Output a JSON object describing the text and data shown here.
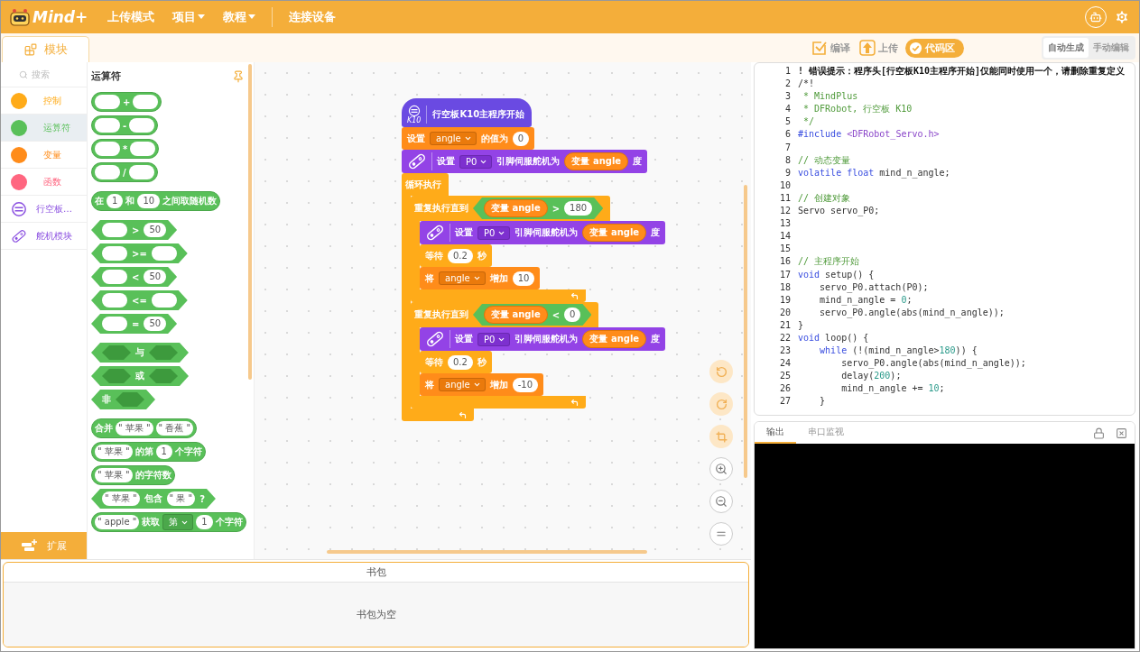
{
  "topbar": {
    "logo": "Mind+",
    "menus": [
      {
        "label": "上传模式",
        "dropdown": false
      },
      {
        "label": "项目",
        "dropdown": true
      },
      {
        "label": "教程",
        "dropdown": true
      }
    ],
    "connect": "连接设备"
  },
  "toolbar": {
    "tab": {
      "label": "模块",
      "selected": true
    },
    "actions": [
      {
        "label": "编译",
        "kind": "compile",
        "selected": false
      },
      {
        "label": "上传",
        "kind": "upload",
        "selected": false
      },
      {
        "label": "代码区",
        "kind": "code",
        "selected": true
      }
    ],
    "modes": [
      {
        "label": "自动生成",
        "selected": true
      },
      {
        "label": "手动编辑",
        "selected": false
      }
    ]
  },
  "categories": {
    "search": {
      "placeholder": "搜索"
    },
    "items": [
      {
        "label": "控制",
        "kind": "dot",
        "color": "#ffab19",
        "selected": false
      },
      {
        "label": "运算符",
        "kind": "dot",
        "color": "#59c059",
        "selected": true
      },
      {
        "label": "变量",
        "kind": "dot",
        "color": "#ff8c1a",
        "selected": false
      },
      {
        "label": "函数",
        "kind": "dot",
        "color": "#ff6680",
        "selected": false
      },
      {
        "label": "行空板…",
        "kind": "board",
        "selected": false
      },
      {
        "label": "舵机模块",
        "kind": "servo",
        "selected": false
      }
    ],
    "extension": "扩展"
  },
  "palette": {
    "title": "运算符",
    "groups": [
      [
        {
          "kind": "round",
          "parts": [
            {
              "kind": "slot"
            },
            {
              "kind": "text",
              "text": "+"
            },
            {
              "kind": "slot"
            }
          ]
        },
        {
          "kind": "round",
          "parts": [
            {
              "kind": "slot"
            },
            {
              "kind": "text",
              "text": "-"
            },
            {
              "kind": "slot"
            }
          ]
        },
        {
          "kind": "round",
          "parts": [
            {
              "kind": "slot"
            },
            {
              "kind": "text",
              "text": "*"
            },
            {
              "kind": "slot"
            }
          ]
        },
        {
          "kind": "round",
          "parts": [
            {
              "kind": "slot"
            },
            {
              "kind": "text",
              "text": "/"
            },
            {
              "kind": "slot"
            }
          ]
        }
      ],
      [
        {
          "kind": "round",
          "parts": [
            {
              "kind": "text",
              "text": "在"
            },
            {
              "kind": "number",
              "text": "1"
            },
            {
              "kind": "text",
              "text": "和"
            },
            {
              "kind": "number",
              "text": "10"
            },
            {
              "kind": "text",
              "text": "之间取随机数"
            }
          ]
        }
      ],
      [
        {
          "kind": "hex",
          "parts": [
            {
              "kind": "slot"
            },
            {
              "kind": "text",
              "text": ">"
            },
            {
              "kind": "number",
              "text": "50"
            }
          ]
        },
        {
          "kind": "hex",
          "parts": [
            {
              "kind": "slot"
            },
            {
              "kind": "text",
              "text": ">="
            },
            {
              "kind": "slot"
            }
          ]
        },
        {
          "kind": "hex",
          "parts": [
            {
              "kind": "slot"
            },
            {
              "kind": "text",
              "text": "<"
            },
            {
              "kind": "number",
              "text": "50"
            }
          ]
        },
        {
          "kind": "hex",
          "parts": [
            {
              "kind": "slot"
            },
            {
              "kind": "text",
              "text": "<="
            },
            {
              "kind": "slot"
            }
          ]
        },
        {
          "kind": "hex",
          "parts": [
            {
              "kind": "slot"
            },
            {
              "kind": "text",
              "text": "="
            },
            {
              "kind": "number",
              "text": "50"
            }
          ]
        }
      ],
      [
        {
          "kind": "hex",
          "parts": [
            {
              "kind": "hexslot"
            },
            {
              "kind": "text",
              "text": "与"
            },
            {
              "kind": "hexslot"
            }
          ]
        },
        {
          "kind": "hex",
          "parts": [
            {
              "kind": "hexslot"
            },
            {
              "kind": "text",
              "text": "或"
            },
            {
              "kind": "hexslot"
            }
          ]
        },
        {
          "kind": "hex",
          "parts": [
            {
              "kind": "text",
              "text": "非"
            },
            {
              "kind": "hexslot"
            }
          ]
        }
      ],
      [
        {
          "kind": "round",
          "parts": [
            {
              "kind": "text",
              "text": "合并"
            },
            {
              "kind": "string",
              "text": "\" 苹果 \""
            },
            {
              "kind": "string",
              "text": "\" 香蕉 \""
            }
          ]
        },
        {
          "kind": "round",
          "parts": [
            {
              "kind": "string",
              "text": "\" 苹果 \""
            },
            {
              "kind": "text",
              "text": "的第"
            },
            {
              "kind": "number",
              "text": "1"
            },
            {
              "kind": "text",
              "text": "个字符"
            }
          ]
        },
        {
          "kind": "round",
          "parts": [
            {
              "kind": "string",
              "text": "\" 苹果 \""
            },
            {
              "kind": "text",
              "text": "的字符数"
            }
          ]
        },
        {
          "kind": "hex",
          "parts": [
            {
              "kind": "string",
              "text": "\" 苹果 \""
            },
            {
              "kind": "text",
              "text": "包含"
            },
            {
              "kind": "string",
              "text": "\" 果 \""
            },
            {
              "kind": "text",
              "text": "?"
            }
          ]
        },
        {
          "kind": "round",
          "parts": [
            {
              "kind": "string",
              "text": "\" apple \""
            },
            {
              "kind": "text",
              "text": "获取"
            },
            {
              "kind": "dropdown",
              "text": "第"
            },
            {
              "kind": "number",
              "text": "1"
            },
            {
              "kind": "text",
              "text": "个字符"
            }
          ]
        }
      ]
    ]
  },
  "script": [
    {
      "kind": "hat",
      "badge": "K10",
      "parts": [
        {
          "kind": "text",
          "text": "行空板K10主程序开始"
        }
      ]
    },
    {
      "kind": "variable",
      "parts": [
        {
          "kind": "text",
          "text": "设置"
        },
        {
          "kind": "dropdown",
          "text": "angle"
        },
        {
          "kind": "text",
          "text": "的值为"
        },
        {
          "kind": "number",
          "text": "0"
        }
      ]
    },
    {
      "kind": "servo",
      "parts": [
        {
          "kind": "text",
          "text": "设置"
        },
        {
          "kind": "dropdown",
          "text": "P0"
        },
        {
          "kind": "text",
          "text": "引脚伺服舵机为"
        },
        {
          "kind": "reporter",
          "text": "变量 angle"
        },
        {
          "kind": "text",
          "text": "度"
        }
      ]
    },
    {
      "kind": "loop",
      "parts": [
        {
          "kind": "text",
          "text": "循环执行"
        }
      ],
      "children": [
        {
          "kind": "repeat",
          "parts": [
            {
              "kind": "text",
              "text": "重复执行直到"
            },
            {
              "kind": "condition",
              "parts": [
                {
                  "kind": "reporter",
                  "text": "变量 angle"
                },
                {
                  "kind": "text",
                  "text": ">"
                },
                {
                  "kind": "number",
                  "text": "180"
                }
              ]
            }
          ],
          "children": [
            {
              "kind": "servo",
              "parts": [
                {
                  "kind": "text",
                  "text": "设置"
                },
                {
                  "kind": "dropdown",
                  "text": "P0"
                },
                {
                  "kind": "text",
                  "text": "引脚伺服舵机为"
                },
                {
                  "kind": "reporter",
                  "text": "变量 angle"
                },
                {
                  "kind": "text",
                  "text": "度"
                }
              ]
            },
            {
              "kind": "wait",
              "parts": [
                {
                  "kind": "text",
                  "text": "等待"
                },
                {
                  "kind": "number",
                  "text": "0.2"
                },
                {
                  "kind": "text",
                  "text": "秒"
                }
              ]
            },
            {
              "kind": "variable",
              "parts": [
                {
                  "kind": "text",
                  "text": "将"
                },
                {
                  "kind": "dropdown",
                  "text": "angle"
                },
                {
                  "kind": "text",
                  "text": "增加"
                },
                {
                  "kind": "number",
                  "text": "10"
                }
              ]
            }
          ]
        },
        {
          "kind": "repeat",
          "parts": [
            {
              "kind": "text",
              "text": "重复执行直到"
            },
            {
              "kind": "condition",
              "parts": [
                {
                  "kind": "reporter",
                  "text": "变量 angle"
                },
                {
                  "kind": "text",
                  "text": "<"
                },
                {
                  "kind": "number",
                  "text": "0"
                }
              ]
            }
          ],
          "children": [
            {
              "kind": "servo",
              "parts": [
                {
                  "kind": "text",
                  "text": "设置"
                },
                {
                  "kind": "dropdown",
                  "text": "P0"
                },
                {
                  "kind": "text",
                  "text": "引脚伺服舵机为"
                },
                {
                  "kind": "reporter",
                  "text": "变量 angle"
                },
                {
                  "kind": "text",
                  "text": "度"
                }
              ]
            },
            {
              "kind": "wait",
              "parts": [
                {
                  "kind": "text",
                  "text": "等待"
                },
                {
                  "kind": "number",
                  "text": "0.2"
                },
                {
                  "kind": "text",
                  "text": "秒"
                }
              ]
            },
            {
              "kind": "variable",
              "parts": [
                {
                  "kind": "text",
                  "text": "将"
                },
                {
                  "kind": "dropdown",
                  "text": "angle"
                },
                {
                  "kind": "text",
                  "text": "增加"
                },
                {
                  "kind": "number",
                  "text": "-10"
                }
              ]
            }
          ]
        }
      ]
    }
  ],
  "code": {
    "lines": [
      {
        "number": "1",
        "tokens": [
          {
            "kind": "error",
            "text": "! 错误提示：程序头[行空板K10主程序开始]仅能同时使用一个，请删除重复定义"
          }
        ]
      },
      {
        "number": "2",
        "tokens": [
          {
            "kind": "plain",
            "text": "/*!"
          }
        ]
      },
      {
        "number": "3",
        "tokens": [
          {
            "kind": "comment",
            "text": " * MindPlus"
          }
        ]
      },
      {
        "number": "4",
        "tokens": [
          {
            "kind": "comment",
            "text": " * DFRobot, 行空板 K10"
          }
        ]
      },
      {
        "number": "5",
        "tokens": [
          {
            "kind": "comment",
            "text": " */"
          }
        ]
      },
      {
        "number": "6",
        "tokens": [
          {
            "kind": "keyword",
            "text": "#include"
          },
          {
            "kind": "string",
            "text": " <DFRobot_Servo.h>"
          }
        ]
      },
      {
        "number": "7"
      },
      {
        "number": "8",
        "tokens": [
          {
            "kind": "comment",
            "text": "// 动态变量"
          }
        ]
      },
      {
        "number": "9",
        "tokens": [
          {
            "kind": "keyword",
            "text": "volatile float"
          },
          {
            "kind": "plain",
            "text": " mind_n_angle;"
          }
        ]
      },
      {
        "number": "10"
      },
      {
        "number": "11",
        "tokens": [
          {
            "kind": "comment",
            "text": "// 创建对象"
          }
        ]
      },
      {
        "number": "12",
        "tokens": [
          {
            "kind": "plain",
            "text": "Servo servo_P0;"
          }
        ]
      },
      {
        "number": "13"
      },
      {
        "number": "14"
      },
      {
        "number": "15"
      },
      {
        "number": "16",
        "tokens": [
          {
            "kind": "comment",
            "text": "// 主程序开始"
          }
        ]
      },
      {
        "number": "17",
        "tokens": [
          {
            "kind": "keyword",
            "text": "void"
          },
          {
            "kind": "plain",
            "text": " setup() {"
          }
        ]
      },
      {
        "number": "18",
        "tokens": [
          {
            "kind": "plain",
            "text": "    servo_P0.attach(P0);"
          }
        ]
      },
      {
        "number": "19",
        "tokens": [
          {
            "kind": "plain",
            "text": "    mind_n_angle = "
          },
          {
            "kind": "number",
            "text": "0"
          },
          {
            "kind": "plain",
            "text": ";"
          }
        ]
      },
      {
        "number": "20",
        "tokens": [
          {
            "kind": "plain",
            "text": "    servo_P0.angle(abs(mind_n_angle));"
          }
        ]
      },
      {
        "number": "21",
        "tokens": [
          {
            "kind": "plain",
            "text": "}"
          }
        ]
      },
      {
        "number": "22",
        "tokens": [
          {
            "kind": "keyword",
            "text": "void"
          },
          {
            "kind": "plain",
            "text": " loop() {"
          }
        ]
      },
      {
        "number": "23",
        "tokens": [
          {
            "kind": "keyword",
            "text": "    while"
          },
          {
            "kind": "plain",
            "text": " (!(mind_n_angle>"
          },
          {
            "kind": "number",
            "text": "180"
          },
          {
            "kind": "plain",
            "text": ")) {"
          }
        ]
      },
      {
        "number": "24",
        "tokens": [
          {
            "kind": "plain",
            "text": "        servo_P0.angle(abs(mind_n_angle));"
          }
        ]
      },
      {
        "number": "25",
        "tokens": [
          {
            "kind": "plain",
            "text": "        delay("
          },
          {
            "kind": "number",
            "text": "200"
          },
          {
            "kind": "plain",
            "text": ");"
          }
        ]
      },
      {
        "number": "26",
        "tokens": [
          {
            "kind": "plain",
            "text": "        mind_n_angle += "
          },
          {
            "kind": "number",
            "text": "10"
          },
          {
            "kind": "plain",
            "text": ";"
          }
        ]
      },
      {
        "number": "27",
        "tokens": [
          {
            "kind": "plain",
            "text": "    }"
          }
        ]
      }
    ]
  },
  "output": {
    "tabs": [
      {
        "label": "输出",
        "selected": true
      },
      {
        "label": "串口监视",
        "selected": false
      }
    ]
  },
  "backpack": {
    "title": "书包",
    "empty_text": "书包为空"
  }
}
